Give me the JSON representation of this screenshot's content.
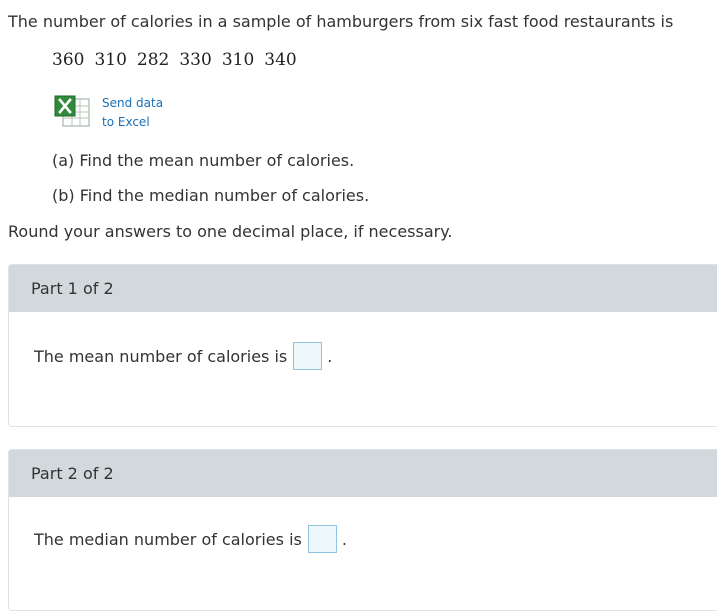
{
  "problem": {
    "stem": "The number of calories in a sample of hamburgers from six fast food restaurants is",
    "values": [
      "360",
      "310",
      "282",
      "330",
      "310",
      "340"
    ],
    "excel_link": {
      "line1": "Send data",
      "line2": "to Excel",
      "icon": "excel-icon"
    },
    "question_a": "(a) Find the mean number of calories.",
    "question_b": "(b) Find the median number of calories.",
    "rounding": "Round your answers to one decimal place, if necessary."
  },
  "parts": [
    {
      "header": "Part 1 of 2",
      "prompt": "The mean number of calories is",
      "suffix": ".",
      "value": ""
    },
    {
      "header": "Part 2 of 2",
      "prompt": "The median number of calories is",
      "suffix": ".",
      "value": ""
    }
  ],
  "colors": {
    "header_bg": "#d1d9dd",
    "link": "#1a6fb5",
    "input_border": "#8fc3df",
    "input_bg": "#eef7fc"
  }
}
